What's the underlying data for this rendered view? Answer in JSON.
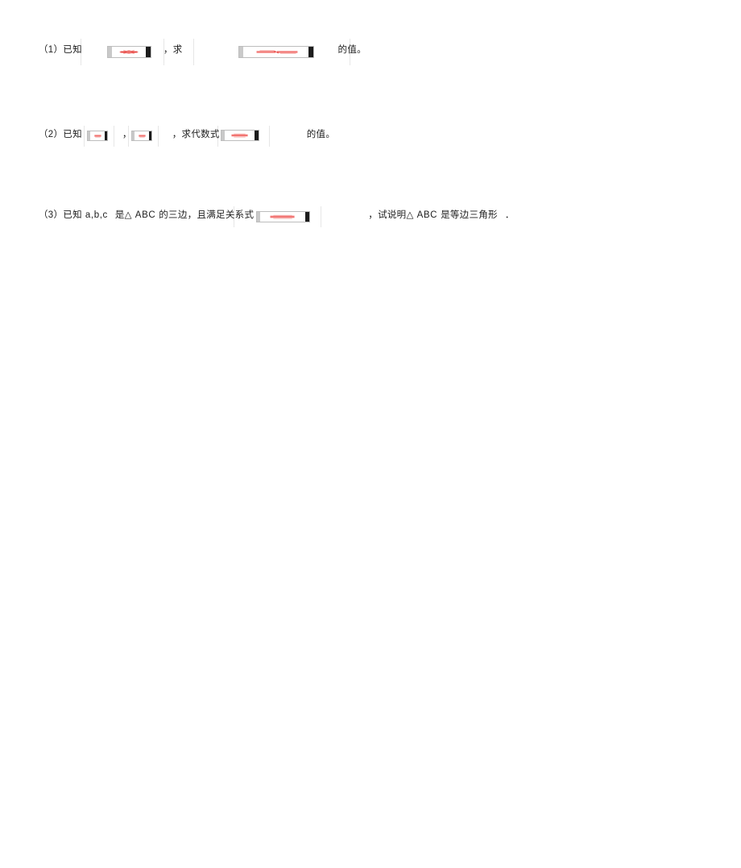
{
  "document": {
    "kind": "math-worksheet",
    "language": "zh-CN",
    "background_color": "#ffffff",
    "text_color": "#1d1d1d",
    "broken_image_ink_color": "#e8413c"
  },
  "problems": [
    {
      "number_label": "（1）",
      "known_label": "已知",
      "formula_1_alt": "broken-formula-image",
      "comma_1": "，",
      "ask_label": "求",
      "formula_2_alt": "broken-formula-image",
      "tail_label": "的值。"
    },
    {
      "number_label": "（2）",
      "known_label": "已知",
      "formula_1_alt": "broken-formula-image",
      "comma_1": "，",
      "formula_2_alt": "broken-formula-image",
      "comma_2": "，",
      "ask_label": "求代数式",
      "formula_3_alt": "broken-formula-image",
      "tail_label": "的值。"
    },
    {
      "number_label": "（3）",
      "known_label": "已知",
      "variables_label": "a,b,c",
      "is_label": "是△",
      "triangle_label": "ABC",
      "sides_label": "的三边，且满足关系式",
      "formula_1_alt": "broken-formula-image",
      "comma_1": "，",
      "explain_label": "试说明△",
      "triangle_label_2": "ABC",
      "conclusion_label": "是等边三角形",
      "period_label": "．"
    }
  ]
}
